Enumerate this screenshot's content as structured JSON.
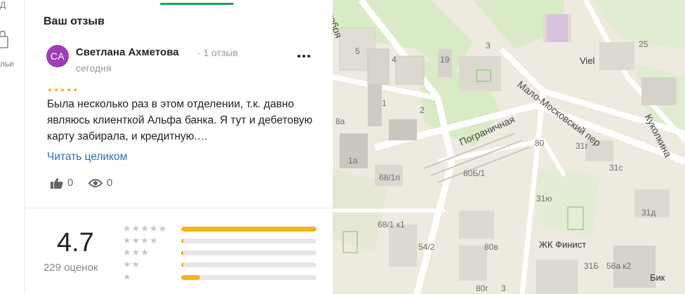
{
  "rail": {
    "top_label": "Д",
    "bottom_label": "лье"
  },
  "panel": {
    "title": "Ваш отзыв",
    "review": {
      "avatar_initials": "СА",
      "avatar_color": "#9c3fb3",
      "author": "Светлана Ахметова",
      "author_reviews": "1 отзыв",
      "date": "сегодня",
      "stars": 5,
      "text": "Была несколько раз в этом отделении, т.к. давно являюсь клиенткой Альфа банка. Я тут и дебетовую карту забирала, и кредитную.…",
      "read_more": "Читать целиком",
      "likes": "0",
      "views": "0"
    },
    "rating": {
      "score": "4.7",
      "count": "229 оценок",
      "distribution": [
        {
          "stars": 5,
          "fraction": 1.0
        },
        {
          "stars": 4,
          "fraction": 0.015
        },
        {
          "stars": 3,
          "fraction": 0.015
        },
        {
          "stars": 2,
          "fraction": 0.015
        },
        {
          "stars": 1,
          "fraction": 0.14
        }
      ],
      "bar_color": "#f5b51d"
    }
  },
  "map": {
    "streets": [
      "Пограничная",
      "Мало-Московский пер",
      "Куколкина",
      "ктября"
    ],
    "pois": [
      "Viel",
      "ЖК Финист",
      "Бик"
    ],
    "house_numbers": [
      "5",
      "4",
      "19",
      "3",
      "1",
      "2",
      "8а",
      "1а",
      "68/1п",
      "80Б/1",
      "80",
      "31г",
      "25",
      "31с",
      "31д",
      "31ю",
      "68/1 к1",
      "54/2",
      "80в",
      "31Б",
      "58а к2",
      "80г",
      "3"
    ]
  }
}
